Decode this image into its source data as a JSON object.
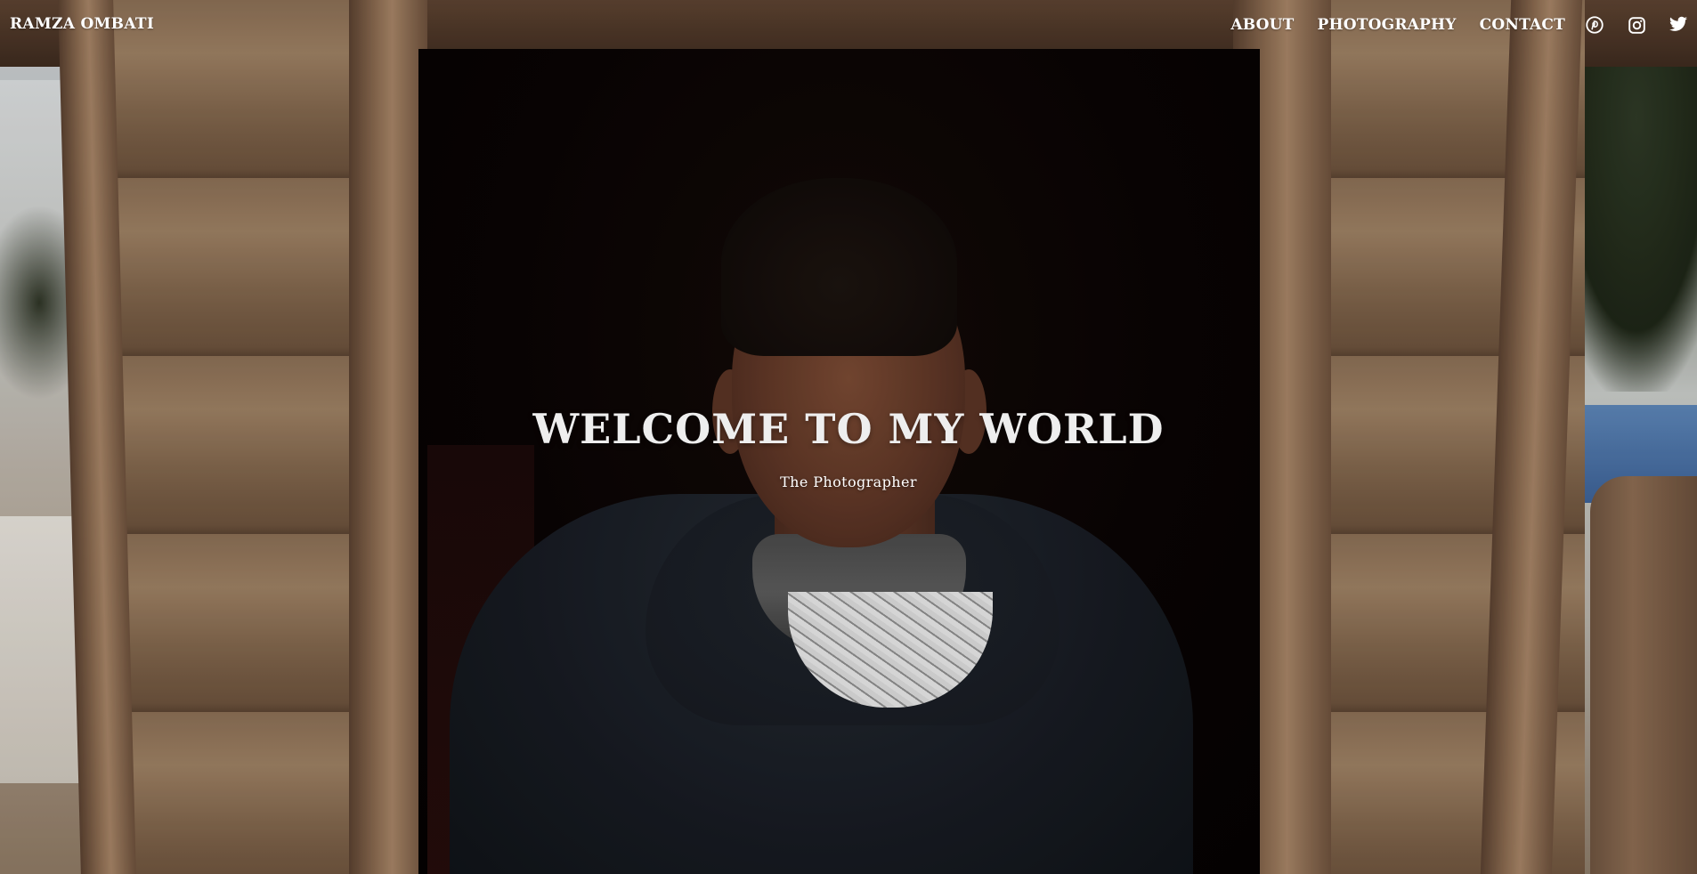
{
  "brand": {
    "name": "RAMZA OMBATI"
  },
  "nav": {
    "links": [
      {
        "label": "ABOUT"
      },
      {
        "label": "PHOTOGRAPHY"
      },
      {
        "label": "CONTACT"
      }
    ],
    "social": [
      {
        "icon": "pinterest-icon"
      },
      {
        "icon": "instagram-icon"
      },
      {
        "icon": "twitter-icon"
      }
    ]
  },
  "hero": {
    "title": "WELCOME TO MY WORLD",
    "subtitle": "The Photographer",
    "colors": {
      "title": "#eeeeee",
      "nav_text": "#ffffff"
    }
  }
}
